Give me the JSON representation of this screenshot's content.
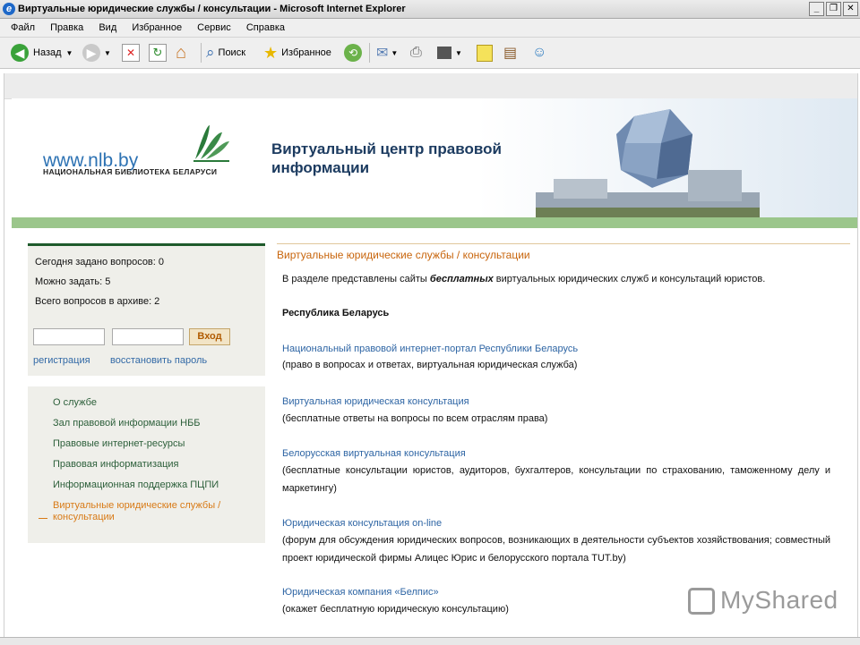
{
  "window": {
    "title": "Виртуальные юридические службы / консультации - Microsoft Internet Explorer"
  },
  "menu": [
    "Файл",
    "Правка",
    "Вид",
    "Избранное",
    "Сервис",
    "Справка"
  ],
  "toolbar": {
    "back": "Назад",
    "search": "Поиск",
    "favorites": "Избранное"
  },
  "site": {
    "url": "www.nlb.by",
    "library": "НАЦИОНАЛЬНАЯ БИБЛИОТЕКА БЕЛАРУСИ",
    "title": "Виртуальный центр правовой информации"
  },
  "sidebar": {
    "stats": [
      "Сегодня задано вопросов: 0",
      "Можно задать: 5",
      "Всего вопросов в архиве: 2"
    ],
    "login_button": "Вход",
    "register": "регистрация",
    "restore_password": "восстановить пароль",
    "nav": [
      "О службе",
      "Зал правовой информации НББ",
      "Правовые интернет-ресурсы",
      "Правовая информатизация",
      "Информационная поддержка ПЦПИ",
      "Виртуальные юридические службы / консультации"
    ]
  },
  "main": {
    "heading": "Виртуальные юридические службы / консультации",
    "intro_before": "В разделе представлены сайты ",
    "intro_em": "бесплатных",
    "intro_after": " виртуальных юридических служб и консультаций юристов.",
    "region": "Республика Беларусь",
    "entries": [
      {
        "title": "Национальный правовой интернет-портал Республики Беларусь",
        "desc": "(право в вопросах и ответах, виртуальная юридическая служба)"
      },
      {
        "title": "Виртуальная юридическая консультация",
        "desc": "(бесплатные ответы на вопросы по всем отраслям права)"
      },
      {
        "title": "Белорусская виртуальная консультация",
        "desc": "(бесплатные консультации юристов, аудиторов, бухгалтеров, консультации по страхованию, таможенному делу и маркетингу)"
      },
      {
        "title": "Юридическая консультация on-line",
        "desc": "(форум для обсуждения юридических вопросов, возникающих в деятельности субъектов хозяйствования; совместный проект юридической фирмы Алицес Юрис и белорусского портала TUT.by)"
      },
      {
        "title": "Юридическая компания «Белпис»",
        "desc": "(окажет бесплатную юридическую консультацию)"
      }
    ]
  },
  "watermark": "MyShared"
}
